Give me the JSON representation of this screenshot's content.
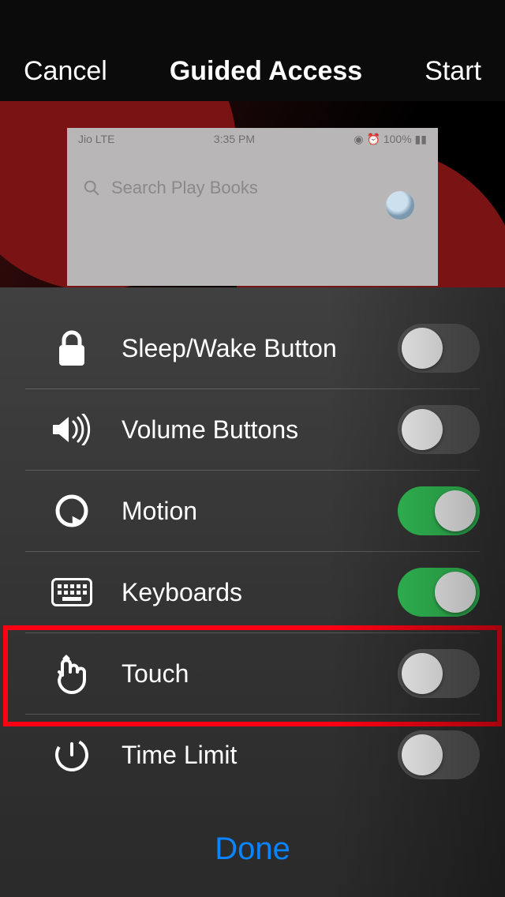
{
  "nav": {
    "cancel": "Cancel",
    "title": "Guided Access",
    "start": "Start"
  },
  "preview": {
    "carrier": "Jio  LTE",
    "time": "3:35 PM",
    "battery": "100%",
    "search_placeholder": "Search Play Books"
  },
  "options": [
    {
      "id": "sleep-wake",
      "label": "Sleep/Wake Button",
      "on": false,
      "icon": "lock-icon"
    },
    {
      "id": "volume",
      "label": "Volume Buttons",
      "on": false,
      "icon": "speaker-icon"
    },
    {
      "id": "motion",
      "label": "Motion",
      "on": true,
      "icon": "rotate-icon"
    },
    {
      "id": "keyboards",
      "label": "Keyboards",
      "on": true,
      "icon": "keyboard-icon"
    },
    {
      "id": "touch",
      "label": "Touch",
      "on": false,
      "icon": "touch-icon",
      "highlighted": true
    },
    {
      "id": "time-limit",
      "label": "Time Limit",
      "on": false,
      "icon": "timer-icon"
    }
  ],
  "footer": {
    "done": "Done"
  }
}
